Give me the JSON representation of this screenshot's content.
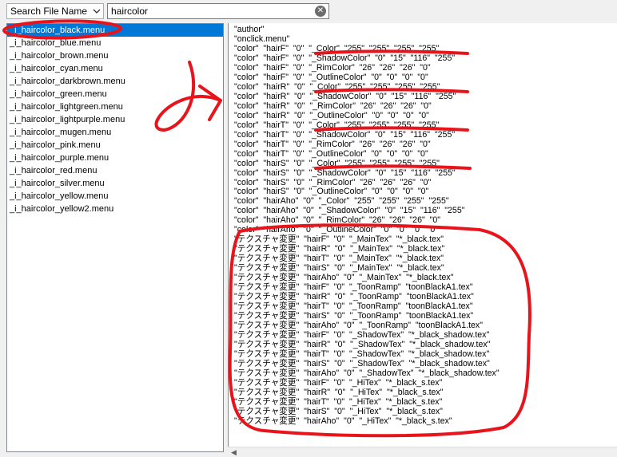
{
  "toolbar": {
    "search_mode": "Search File Name",
    "search_value": "haircolor",
    "clear_symbol": "✕"
  },
  "file_list": {
    "items": [
      "_i_haircolor_black.menu",
      "_i_haircolor_blue.menu",
      "_i_haircolor_brown.menu",
      "_i_haircolor_cyan.menu",
      "_i_haircolor_darkbrown.menu",
      "_i_haircolor_green.menu",
      "_i_haircolor_lightgreen.menu",
      "_i_haircolor_lightpurple.menu",
      "_i_haircolor_mugen.menu",
      "_i_haircolor_pink.menu",
      "_i_haircolor_purple.menu",
      "_i_haircolor_red.menu",
      "_i_haircolor_silver.menu",
      "_i_haircolor_yellow.menu",
      "_i_haircolor_yellow2.menu"
    ],
    "selected_index": 0
  },
  "content": {
    "lines": [
      "\"author\"",
      "\"onclick.menu\"",
      "\"color\"  \"hairF\"  \"0\"  \"_Color\"  \"255\"  \"255\"  \"255\"  \"255\"",
      "\"color\"  \"hairF\"  \"0\"  \"_ShadowColor\"  \"0\"  \"15\"  \"116\"  \"255\"",
      "\"color\"  \"hairF\"  \"0\"  \"_RimColor\"  \"26\"  \"26\"  \"26\"  \"0\"",
      "\"color\"  \"hairF\"  \"0\"  \"_OutlineColor\"  \"0\"  \"0\"  \"0\"  \"0\"",
      "\"color\"  \"hairR\"  \"0\"  \"_Color\"  \"255\"  \"255\"  \"255\"  \"255\"",
      "\"color\"  \"hairR\"  \"0\"  \"_ShadowColor\"  \"0\"  \"15\"  \"116\"  \"255\"",
      "\"color\"  \"hairR\"  \"0\"  \"_RimColor\"  \"26\"  \"26\"  \"26\"  \"0\"",
      "\"color\"  \"hairR\"  \"0\"  \"_OutlineColor\"  \"0\"  \"0\"  \"0\"  \"0\"",
      "\"color\"  \"hairT\"  \"0\"  \"_Color\"  \"255\"  \"255\"  \"255\"  \"255\"",
      "\"color\"  \"hairT\"  \"0\"  \"_ShadowColor\"  \"0\"  \"15\"  \"116\"  \"255\"",
      "\"color\"  \"hairT\"  \"0\"  \"_RimColor\"  \"26\"  \"26\"  \"26\"  \"0\"",
      "\"color\"  \"hairT\"  \"0\"  \"_OutlineColor\"  \"0\"  \"0\"  \"0\"  \"0\"",
      "\"color\"  \"hairS\"  \"0\"  \"_Color\"  \"255\"  \"255\"  \"255\"  \"255\"",
      "\"color\"  \"hairS\"  \"0\"  \"_ShadowColor\"  \"0\"  \"15\"  \"116\"  \"255\"",
      "\"color\"  \"hairS\"  \"0\"  \"_RimColor\"  \"26\"  \"26\"  \"26\"  \"0\"",
      "\"color\"  \"hairS\"  \"0\"  \"_OutlineColor\"  \"0\"  \"0\"  \"0\"  \"0\"",
      "\"color\"  \"hairAho\"  \"0\"  \"_Color\"  \"255\"  \"255\"  \"255\"  \"255\"",
      "\"color\"  \"hairAho\"  \"0\"  \"_ShadowColor\"  \"0\"  \"15\"  \"116\"  \"255\"",
      "\"color\"  \"hairAho\"  \"0\"  \"_RimColor\"  \"26\"  \"26\"  \"26\"  \"0\"",
      "\"color\"  \"hairAho\"  \"0\"  \"_OutlineColor\"  \"0\"  \"0\"  \"0\"  \"0\"",
      "\"テクスチャ変更\"  \"hairF\"  \"0\"  \"_MainTex\"  \"*_black.tex\"",
      "\"テクスチャ変更\"  \"hairR\"  \"0\"  \"_MainTex\"  \"*_black.tex\"",
      "\"テクスチャ変更\"  \"hairT\"  \"0\"  \"_MainTex\"  \"*_black.tex\"",
      "\"テクスチャ変更\"  \"hairS\"  \"0\"  \"_MainTex\"  \"*_black.tex\"",
      "\"テクスチャ変更\"  \"hairAho\"  \"0\"  \"_MainTex\"  \"*_black.tex\"",
      "\"テクスチャ変更\"  \"hairF\"  \"0\"  \"_ToonRamp\"  \"toonBlackA1.tex\"",
      "\"テクスチャ変更\"  \"hairR\"  \"0\"  \"_ToonRamp\"  \"toonBlackA1.tex\"",
      "\"テクスチャ変更\"  \"hairT\"  \"0\"  \"_ToonRamp\"  \"toonBlackA1.tex\"",
      "\"テクスチャ変更\"  \"hairS\"  \"0\"  \"_ToonRamp\"  \"toonBlackA1.tex\"",
      "\"テクスチャ変更\"  \"hairAho\"  \"0\"  \"_ToonRamp\"  \"toonBlackA1.tex\"",
      "\"テクスチャ変更\"  \"hairF\"  \"0\"  \"_ShadowTex\"  \"*_black_shadow.tex\"",
      "\"テクスチャ変更\"  \"hairR\"  \"0\"  \"_ShadowTex\"  \"*_black_shadow.tex\"",
      "\"テクスチャ変更\"  \"hairT\"  \"0\"  \"_ShadowTex\"  \"*_black_shadow.tex\"",
      "\"テクスチャ変更\"  \"hairS\"  \"0\"  \"_ShadowTex\"  \"*_black_shadow.tex\"",
      "\"テクスチャ変更\"  \"hairAho\"  \"0\"  \"_ShadowTex\"  \"*_black_shadow.tex\"",
      "\"テクスチャ変更\"  \"hairF\"  \"0\"  \"_HiTex\"  \"*_black_s.tex\"",
      "\"テクスチャ変更\"  \"hairR\"  \"0\"  \"_HiTex\"  \"*_black_s.tex\"",
      "\"テクスチャ変更\"  \"hairT\"  \"0\"  \"_HiTex\"  \"*_black_s.tex\"",
      "\"テクスチャ変更\"  \"hairS\"  \"0\"  \"_HiTex\"  \"*_black_s.tex\"",
      "\"テクスチャ変更\"  \"hairAho\"  \"0\"  \"_HiTex\"  \"*_black_s.tex\""
    ]
  },
  "scrollbar": {
    "left_arrow": "◀"
  },
  "colors": {
    "selection": "#0078d7",
    "annotation": "#e8141c"
  },
  "icons": {
    "dropdown": "chevron-down-icon",
    "clear": "clear-search-icon",
    "scroll_left": "scroll-left-arrow-icon"
  }
}
